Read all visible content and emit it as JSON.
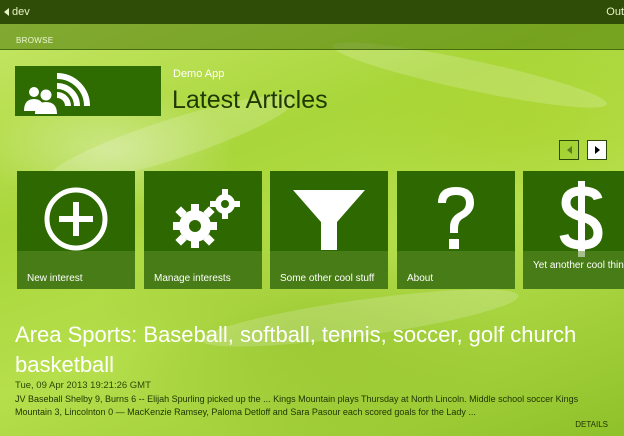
{
  "topbar": {
    "back_label": "dev",
    "right_label": "Out"
  },
  "browse": {
    "label": "BROWSE"
  },
  "header": {
    "app_name": "Demo App",
    "title": "Latest Articles"
  },
  "logo": {
    "icon": "people-broadcast-icon"
  },
  "pager": {
    "prev_icon": "chevron-left-icon",
    "next_icon": "chevron-right-icon"
  },
  "tiles": [
    {
      "label": "New interest",
      "icon": "plus-circle-icon"
    },
    {
      "label": "Manage interests",
      "icon": "gears-icon"
    },
    {
      "label": "Some other cool stuff",
      "icon": "funnel-icon"
    },
    {
      "label": "About",
      "icon": "question-icon"
    },
    {
      "label": "Yet another cool thing",
      "icon": "dollar-icon"
    }
  ],
  "article": {
    "title": "Area Sports: Baseball, softball, tennis, soccer, golf church basketball",
    "date": "Tue, 09 Apr 2013 19:21:26 GMT",
    "excerpt": "JV Baseball Shelby 9, Burns 6 -- Elijah Spurling picked up the ... Kings Mountain plays Thursday at North Lincoln. Middle school soccer Kings Mountain 3, Lincolnton 0 — MacKenzie Ramsey, Paloma Detloff and Sara Pasour each scored goals for the Lady ...",
    "details_label": "DETAILS"
  },
  "colors": {
    "tile": "#2d6900",
    "topbar": "#2f4d06",
    "accent": "#a9d63a"
  }
}
